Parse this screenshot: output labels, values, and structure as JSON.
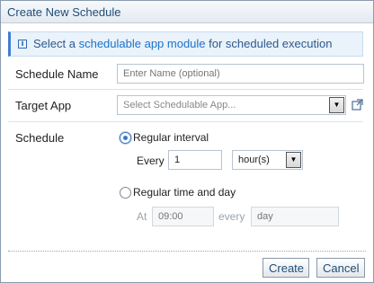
{
  "dialog": {
    "title": "Create New Schedule"
  },
  "info": {
    "prefix": "Select a ",
    "link": "schedulable app module",
    "suffix": " for scheduled execution"
  },
  "form": {
    "schedule_name": {
      "label": "Schedule Name",
      "placeholder": "Enter Name (optional)",
      "value": ""
    },
    "target_app": {
      "label": "Target App",
      "placeholder": "Select Schedulable App..."
    },
    "schedule": {
      "label": "Schedule",
      "regular_interval": {
        "label": "Regular interval",
        "selected": true,
        "every_label": "Every",
        "every_value": "1",
        "unit": "hour(s)"
      },
      "regular_time": {
        "label": "Regular time and day",
        "selected": false,
        "at_label": "At",
        "at_placeholder": "09:00",
        "every_label": "every",
        "day_placeholder": "day"
      }
    }
  },
  "buttons": {
    "create": "Create",
    "cancel": "Cancel"
  },
  "colors": {
    "accent": "#3b78c3",
    "title": "#1f4d78",
    "info_bg": "#eaf2fb"
  }
}
